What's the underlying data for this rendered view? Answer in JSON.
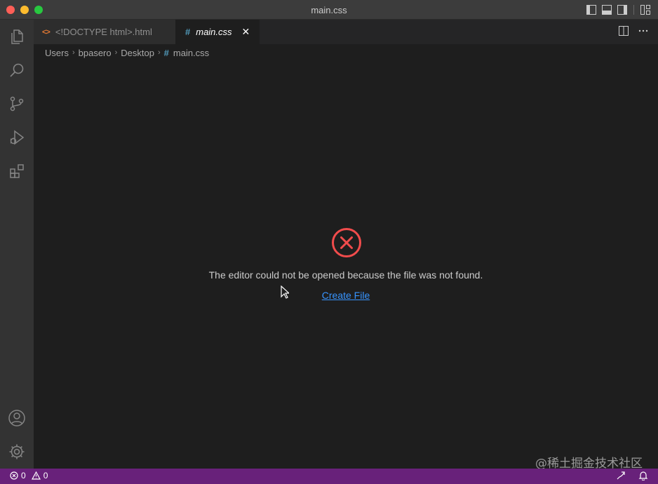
{
  "window": {
    "title": "main.css"
  },
  "tabs": [
    {
      "label": "<!DOCTYPE html>.html",
      "icon": "html-file-icon",
      "active": false
    },
    {
      "label": "main.css",
      "icon": "css-file-icon",
      "active": true
    }
  ],
  "tab_icons": {
    "html": "<>",
    "css": "#",
    "close": "✕"
  },
  "breadcrumb": {
    "items": [
      "Users",
      "bpasero",
      "Desktop",
      "main.css"
    ],
    "chevron": "›",
    "file_icon": "#"
  },
  "editor": {
    "error_message": "The editor could not be opened because the file was not found.",
    "create_file_label": "Create File",
    "error_color": "#f14c4c",
    "link_color": "#3794ff"
  },
  "status_bar": {
    "errors": "0",
    "warnings": "0",
    "background": "#68217a"
  },
  "watermark": "@稀土掘金技术社区"
}
